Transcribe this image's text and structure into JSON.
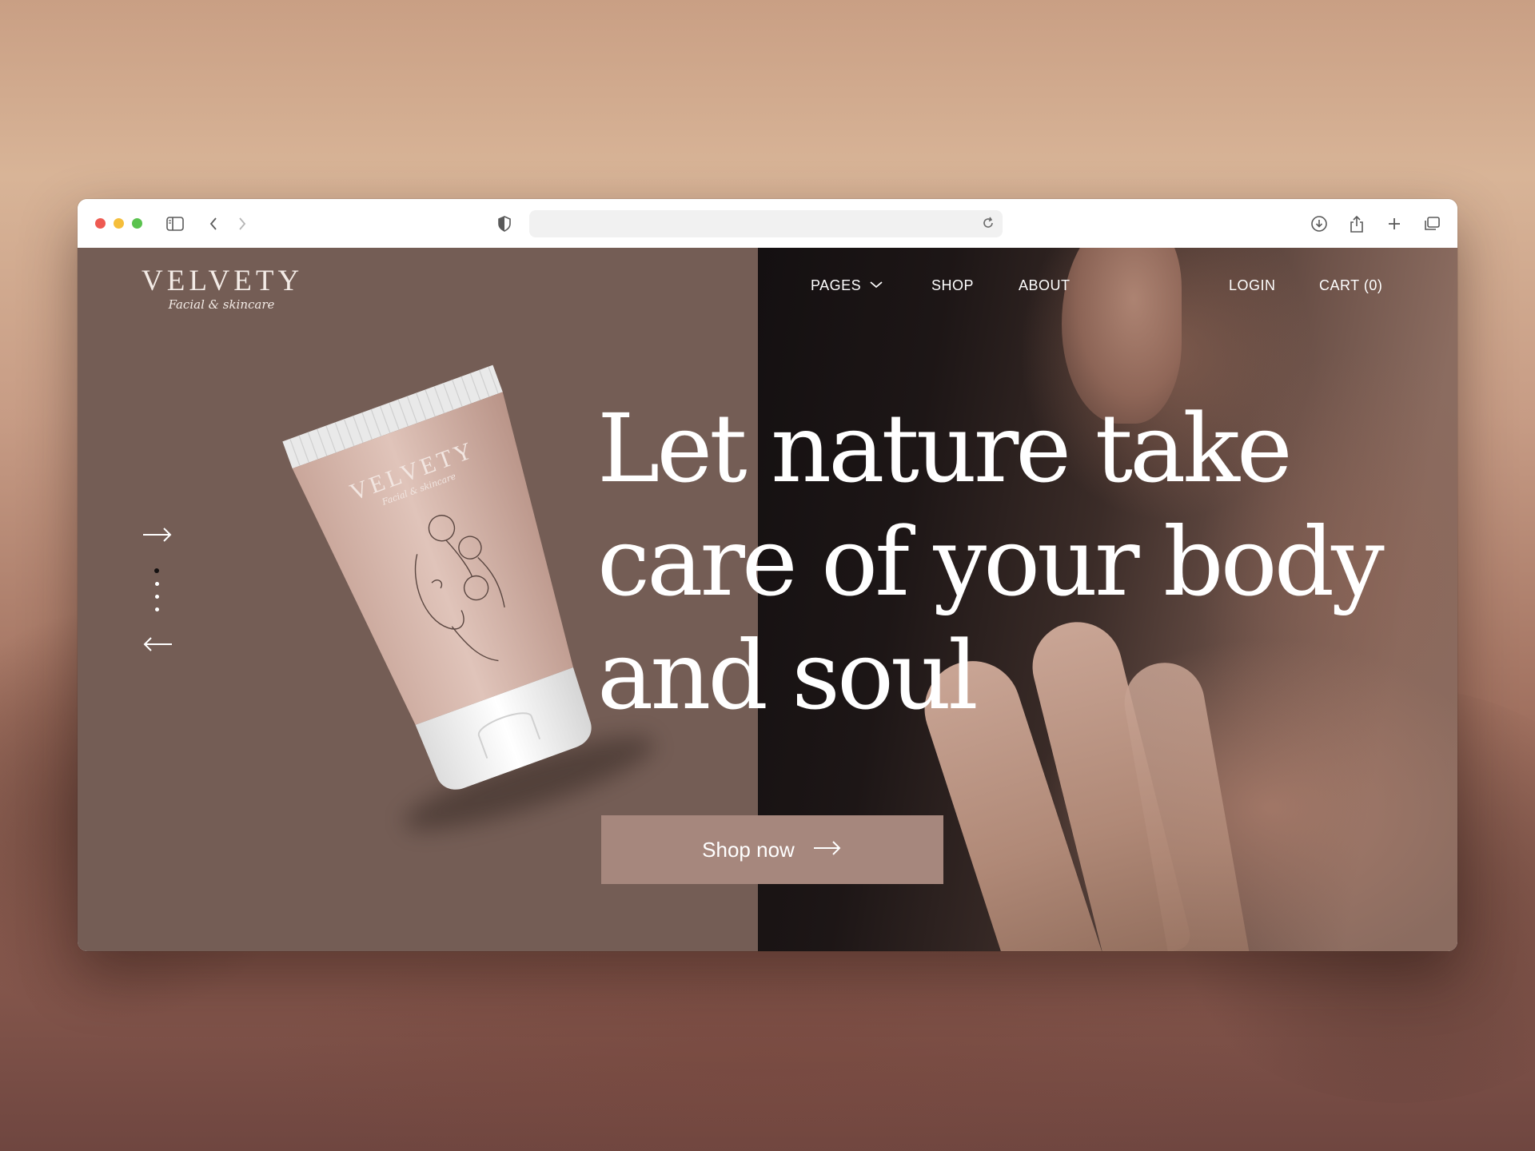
{
  "browser": {
    "icons": [
      "sidebar-icon",
      "back-icon",
      "forward-icon",
      "shield-icon",
      "reload-icon",
      "download-icon",
      "share-icon",
      "new-tab-icon",
      "tabs-overview-icon"
    ]
  },
  "site": {
    "logo": {
      "brand": "VELVETY",
      "tagline": "Facial & skincare"
    },
    "nav": {
      "pages": "PAGES",
      "shop": "SHOP",
      "about": "ABOUT",
      "login": "LOGIN",
      "cart": "CART (0)"
    },
    "hero": {
      "headline_lines": [
        "Let nature take",
        "care of your body",
        "and soul"
      ],
      "cta": "Shop now",
      "slider_dots": 4,
      "active_slide": 1
    },
    "colors": {
      "left_panel": "#745d55",
      "cta_background": "#a6877d",
      "product_tube": "#d7b9ae"
    }
  }
}
